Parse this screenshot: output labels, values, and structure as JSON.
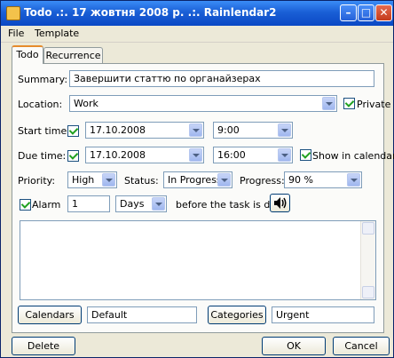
{
  "window": {
    "title": "Todo .:. 17 жовтня 2008 р. .:. Rainlendar2",
    "controls": [
      "minimize",
      "maximize",
      "close"
    ]
  },
  "menu": [
    "File",
    "Template"
  ],
  "tabs": [
    {
      "label": "Todo",
      "active": true
    },
    {
      "label": "Recurrence",
      "active": false
    }
  ],
  "form": {
    "summary_label": "Summary:",
    "summary_value": "Завершити статтю по органайзерах",
    "location_label": "Location:",
    "location_value": "Work",
    "private_label": "Private",
    "private_checked": true,
    "start_label": "Start time:",
    "start_checked": true,
    "start_date": "17.10.2008",
    "start_time": "9:00",
    "due_label": "Due time:",
    "due_checked": true,
    "due_date": "17.10.2008",
    "due_time": "16:00",
    "show_in_calendar_label": "Show in calendar",
    "show_in_calendar_checked": true,
    "priority_label": "Priority:",
    "priority_value": "High",
    "status_label": "Status:",
    "status_value": "In Progress",
    "progress_label": "Progress:",
    "progress_value": "90 %",
    "alarm_label": "Alarm",
    "alarm_checked": true,
    "alarm_amount": "1",
    "alarm_unit": "Days",
    "alarm_suffix": "before the task is due.",
    "calendars_button": "Calendars",
    "calendars_value": "Default",
    "categories_button": "Categories",
    "categories_value": "Urgent"
  },
  "footer": {
    "delete": "Delete",
    "ok": "OK",
    "cancel": "Cancel"
  },
  "colors": {
    "titlebar": "#1a5fd6",
    "window_bg": "#ece9d8",
    "panel_bg": "#fbfbf9",
    "check_mark": "#21a121"
  },
  "icons": [
    "app-icon",
    "speaker-icon",
    "dropdown-arrow-icon"
  ]
}
